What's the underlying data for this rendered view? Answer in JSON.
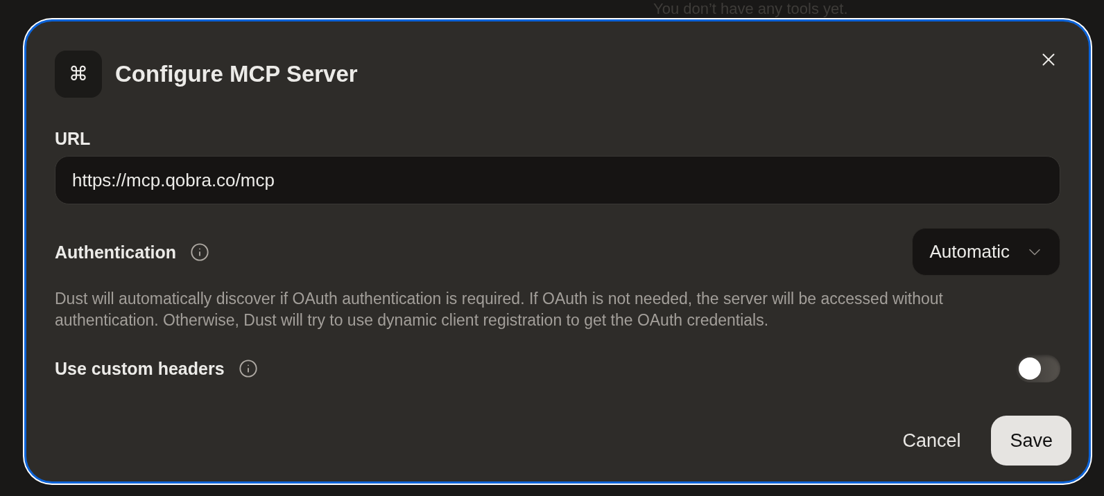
{
  "background": {
    "empty_message": "You don’t have any tools yet."
  },
  "dialog": {
    "icon_glyph": "⌘",
    "title": "Configure MCP Server",
    "url_field": {
      "label": "URL",
      "value": "https://mcp.qobra.co/mcp"
    },
    "authentication": {
      "label": "Authentication",
      "select": {
        "value": "Automatic"
      },
      "description": "Dust will automatically discover if OAuth authentication is required. If OAuth is not needed, the server will be accessed without authentication. Otherwise, Dust will try to use dynamic client registration to get the OAuth credentials."
    },
    "custom_headers": {
      "label": "Use custom headers",
      "on": false
    },
    "buttons": [
      {
        "label": "Cancel",
        "kind": "ghost"
      },
      {
        "label": "Save",
        "kind": "primary"
      }
    ]
  }
}
